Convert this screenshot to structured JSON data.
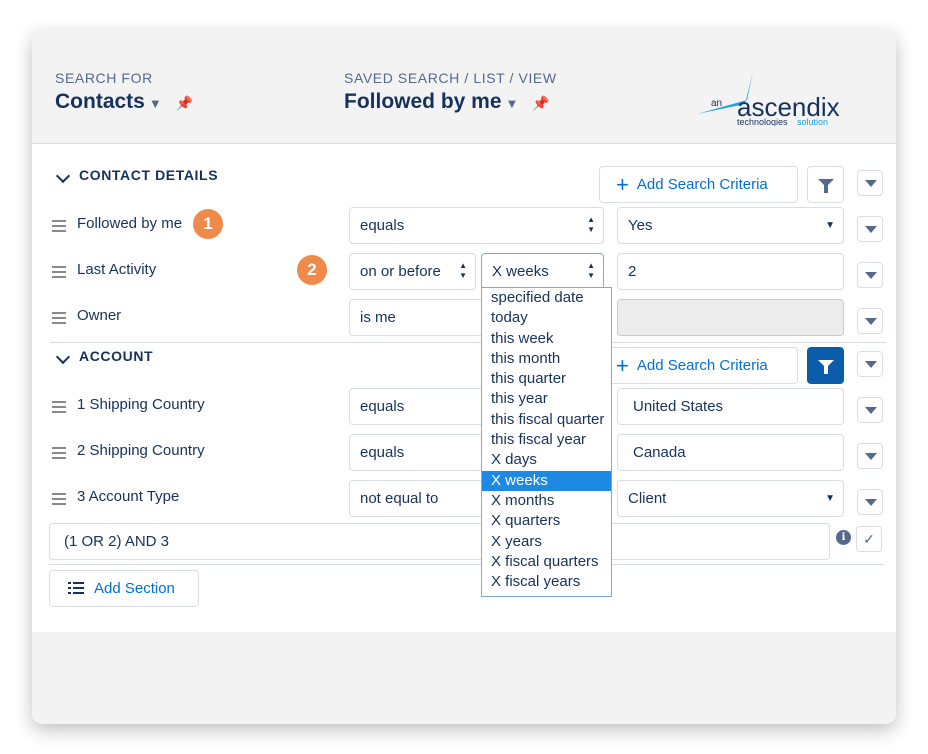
{
  "header": {
    "search_for_label": "SEARCH FOR",
    "search_for_value": "Contacts",
    "saved_search_label": "SAVED SEARCH / LIST / VIEW",
    "saved_search_value": "Followed by me",
    "logo": {
      "prefix": "an",
      "brand": "ascendix",
      "tagline_a": "technologies",
      "tagline_b": "solution"
    }
  },
  "sections": {
    "contact": {
      "title": "CONTACT DETAILS",
      "add_criteria": "Add Search Criteria",
      "rows": [
        {
          "label": "Followed by me",
          "operator": "equals",
          "value": "Yes"
        },
        {
          "label": "Last Activity",
          "operator": "on or before",
          "unit": "X weeks",
          "value": "2"
        },
        {
          "label": "Owner",
          "operator": "is me",
          "value": ""
        }
      ]
    },
    "account": {
      "title": "ACCOUNT",
      "add_criteria": "Add Search Criteria",
      "rows": [
        {
          "label": "1 Shipping Country",
          "operator": "equals",
          "value": "United States"
        },
        {
          "label": "2 Shipping Country",
          "operator": "equals",
          "value": "Canada"
        },
        {
          "label": "3 Account Type",
          "operator": "not equal to",
          "value": "Client"
        }
      ],
      "logic": "(1 OR 2) AND 3"
    }
  },
  "badges": [
    "1",
    "2"
  ],
  "add_section": "Add Section",
  "date_dropdown": {
    "selected": "X weeks",
    "options": [
      "specified date",
      "today",
      "this week",
      "this month",
      "this quarter",
      "this year",
      "this fiscal quarter",
      "this fiscal year",
      "X days",
      "X weeks",
      "X months",
      "X quarters",
      "X years",
      "X fiscal quarters",
      "X fiscal years"
    ]
  },
  "colors": {
    "accent": "#0070d2",
    "active_filter": "#0b5cab",
    "badge": "#f08a4b",
    "selected_option": "#1e88e5"
  },
  "icons": [
    "chevron-down-icon",
    "pin-icon",
    "drag-handle-icon",
    "filter-icon",
    "plus-icon",
    "info-icon",
    "check-icon",
    "list-icon"
  ]
}
